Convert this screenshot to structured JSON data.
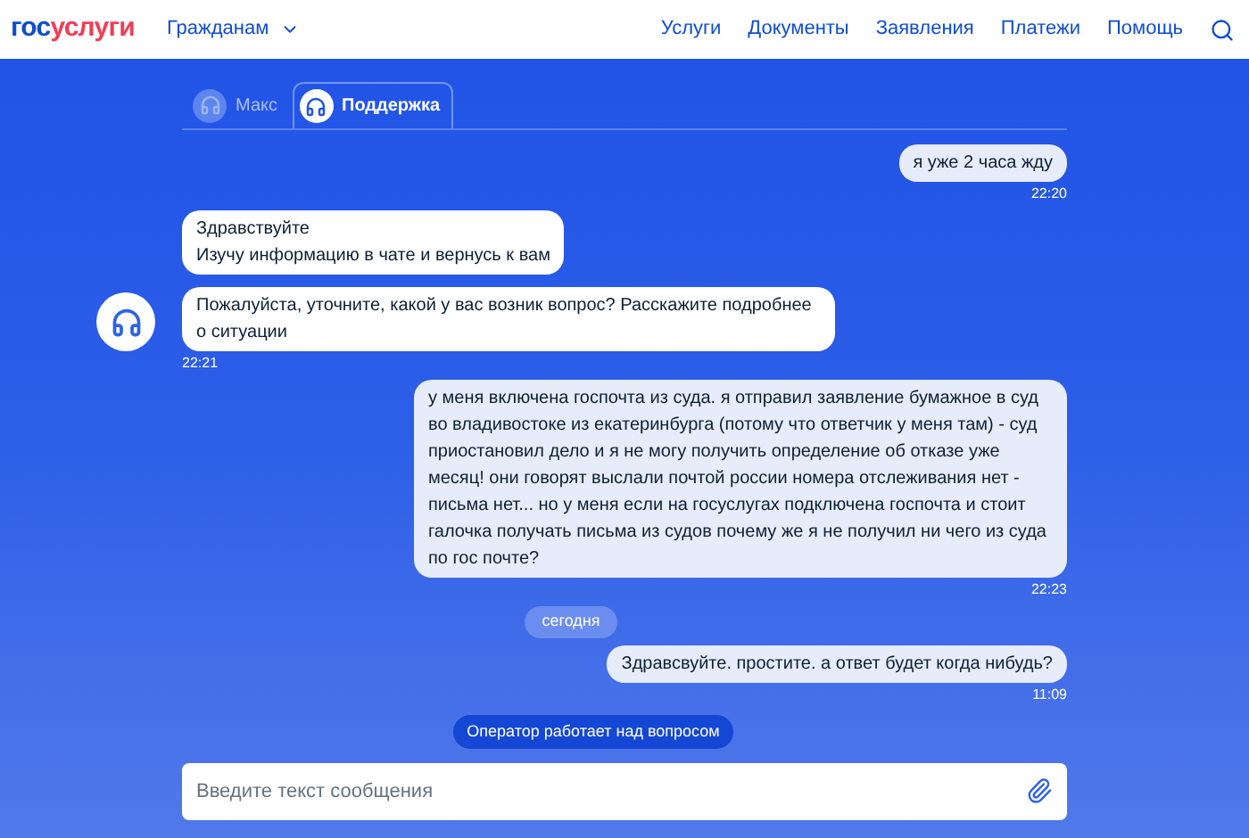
{
  "logo": [
    {
      "text": "гос",
      "color": "#0d4cd3"
    },
    {
      "text": "услуги",
      "color": "#ee3f58"
    }
  ],
  "header": {
    "audience": "Гражданам",
    "nav": [
      "Услуги",
      "Документы",
      "Заявления",
      "Платежи",
      "Помощь"
    ]
  },
  "tabs": [
    {
      "label": "Макс",
      "selected": false
    },
    {
      "label": "Поддержка",
      "selected": true
    }
  ],
  "feed": [
    {
      "kind": "user_group",
      "bubbles": [
        "я уже 2 часа жду"
      ],
      "time": "22:20"
    },
    {
      "kind": "operator_group",
      "bubbles": [
        "Здравствуйте\nИзучу информацию в чате и вернусь к вам",
        "Пожалуйста, уточните, какой у вас возник вопрос? Расскажите подробнее о ситуации"
      ],
      "time": "22:21"
    },
    {
      "kind": "user_group",
      "bubbles": [
        "у меня включена госпочта из суда. я отправил заявление бумажное в суд во владивостоке из екатеринбурга (потому что ответчик у меня там) - суд приостановил дело и я не могу получить определение об отказе уже месяц! они говорят выслали почтой россии номера отслеживания нет - письма нет... но у меня если на госуслугах подключена госпочта и стоит галочка получать письма из судов почему же я не получил ни чего из суда по гос почте?"
      ],
      "time": "22:23"
    },
    {
      "kind": "date",
      "text": "сегодня"
    },
    {
      "kind": "user_group",
      "bubbles": [
        "Здравсвуйте. простите. а ответ будет когда нибудь?"
      ],
      "time": "11:09"
    },
    {
      "kind": "status",
      "text": "Оператор работает над вопросом"
    }
  ],
  "composer": {
    "placeholder": "Введите текст сообщения"
  }
}
